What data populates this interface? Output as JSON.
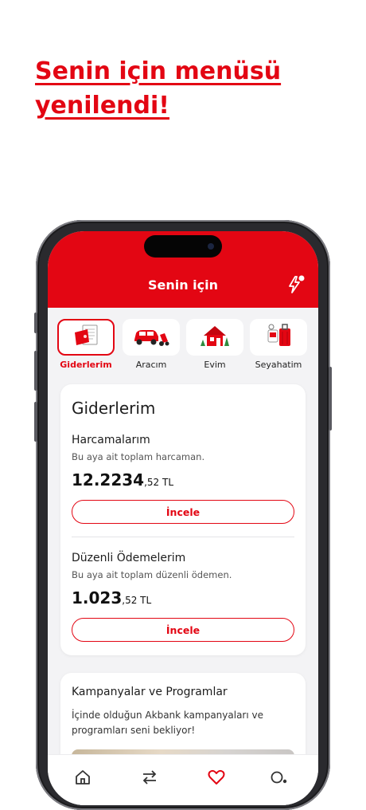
{
  "headline": {
    "line1": "Senin için menüsü",
    "line2": "yenilendi!"
  },
  "header": {
    "title": "Senin için"
  },
  "categories": [
    {
      "label": "Giderlerim",
      "icon": "expenses-icon",
      "active": true
    },
    {
      "label": "Aracım",
      "icon": "car-icon",
      "active": false
    },
    {
      "label": "Evim",
      "icon": "house-icon",
      "active": false
    },
    {
      "label": "Seyahatim",
      "icon": "luggage-icon",
      "active": false
    }
  ],
  "expenses_card": {
    "title": "Giderlerim",
    "spending": {
      "title": "Harcamalarım",
      "subtitle": "Bu aya ait toplam harcaman.",
      "amount_main": "12.2234",
      "amount_decimal": ",52 TL",
      "button": "İncele"
    },
    "regular": {
      "title": "Düzenli Ödemelerim",
      "subtitle": "Bu aya ait toplam düzenli ödemen.",
      "amount_main": "1.023",
      "amount_decimal": ",52 TL",
      "button": "İncele"
    }
  },
  "campaign_card": {
    "title": "Kampanyalar ve Programlar",
    "body": "İçinde olduğun Akbank kampanyaları ve programları seni bekliyor!"
  },
  "tabbar": {
    "items": [
      {
        "icon": "home-icon"
      },
      {
        "icon": "transfer-icon"
      },
      {
        "icon": "heart-icon",
        "active": true
      },
      {
        "icon": "search-icon"
      }
    ]
  },
  "colors": {
    "brand": "#e30613",
    "background": "#f3f3f5"
  }
}
